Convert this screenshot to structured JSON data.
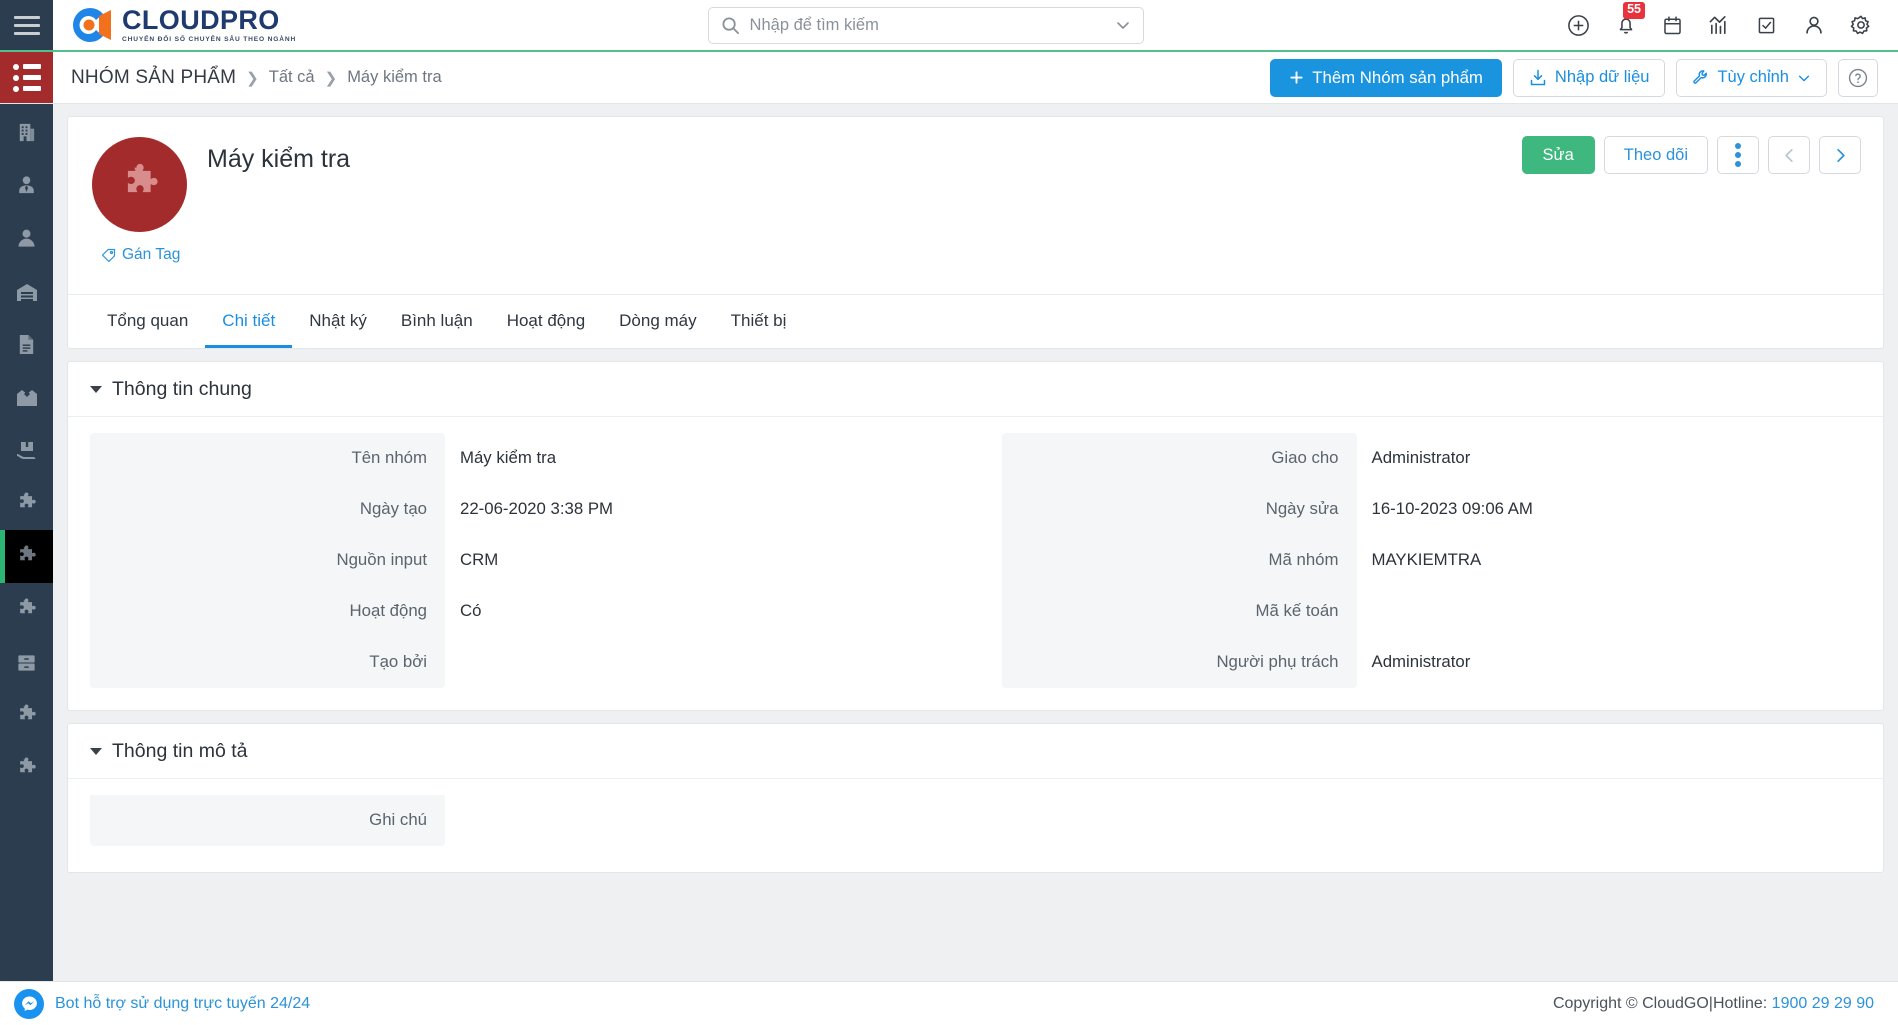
{
  "brand": {
    "name": "CLOUDPRO",
    "tagline": "CHUYỂN ĐỔI SỐ CHUYÊN SÂU THEO NGÀNH",
    "accent_blue": "#1a94de",
    "accent_green": "#52c08a",
    "sidebar_bg": "#2b3d4f",
    "red": "#a32b2b"
  },
  "topbar": {
    "menu_icon": "hamburger-icon",
    "search": {
      "placeholder": "Nhập để tìm kiếm",
      "value": "",
      "icon": "search-icon",
      "dropdown_icon": "chevron-down-icon"
    },
    "icons": [
      {
        "name": "add-circle-icon",
        "glyph": "plus"
      },
      {
        "name": "notifications-bell-icon",
        "glyph": "bell",
        "badge": "55"
      },
      {
        "name": "calendar-icon",
        "glyph": "calendar"
      },
      {
        "name": "reports-chart-icon",
        "glyph": "chart"
      },
      {
        "name": "tasks-checkbox-icon",
        "glyph": "check"
      },
      {
        "name": "user-account-icon",
        "glyph": "user"
      },
      {
        "name": "settings-gear-icon",
        "glyph": "gear"
      }
    ]
  },
  "actionbar": {
    "module_icon": "list-module-icon",
    "breadcrumb": {
      "module": "NHÓM SẢN PHẨM",
      "items": [
        "Tất cả",
        "Máy kiểm tra"
      ],
      "separator": "❯"
    },
    "buttons": {
      "add": "Thêm Nhóm sản phẩm",
      "import": "Nhập dữ liệu",
      "customize": "Tùy chỉnh",
      "help_icon": "help-circle-icon"
    }
  },
  "sidebar": {
    "items": [
      {
        "name": "sidebar-item-organizations",
        "icon": "building-icon",
        "active": false
      },
      {
        "name": "sidebar-item-contacts",
        "icon": "user-tie-icon",
        "active": false
      },
      {
        "name": "sidebar-item-persons",
        "icon": "person-icon",
        "active": false
      },
      {
        "name": "sidebar-item-warehouse",
        "icon": "warehouse-icon",
        "active": false
      },
      {
        "name": "sidebar-item-documents",
        "icon": "document-icon",
        "active": false
      },
      {
        "name": "sidebar-item-open-box",
        "icon": "open-box-icon",
        "active": false
      },
      {
        "name": "sidebar-item-delivery",
        "icon": "box-hand-icon",
        "active": false
      },
      {
        "name": "sidebar-item-products",
        "icon": "puzzle-icon",
        "active": false
      },
      {
        "name": "sidebar-item-product-group",
        "icon": "puzzle-icon",
        "active": true
      },
      {
        "name": "sidebar-item-modules",
        "icon": "puzzle-icon",
        "active": false
      },
      {
        "name": "sidebar-item-archive",
        "icon": "archive-drawer-icon",
        "active": false
      },
      {
        "name": "sidebar-item-extensions",
        "icon": "puzzle-icon",
        "active": false
      },
      {
        "name": "sidebar-item-addons",
        "icon": "puzzle-icon",
        "active": false
      }
    ]
  },
  "record": {
    "avatar_icon": "puzzle-icon",
    "title": "Máy kiểm tra",
    "tag_label": "Gán Tag",
    "tag_icon": "tag-icon",
    "actions": {
      "edit": "Sửa",
      "follow": "Theo dõi",
      "more_icon": "vertical-dots-icon",
      "prev_icon": "chevron-left-icon",
      "next_icon": "chevron-right-icon"
    }
  },
  "tabs": [
    {
      "label": "Tổng quan",
      "active": false
    },
    {
      "label": "Chi tiết",
      "active": true
    },
    {
      "label": "Nhật ký",
      "active": false
    },
    {
      "label": "Bình luận",
      "active": false
    },
    {
      "label": "Hoạt động",
      "active": false
    },
    {
      "label": "Dòng máy",
      "active": false
    },
    {
      "label": "Thiết bị",
      "active": false
    }
  ],
  "sections": [
    {
      "title": "Thông tin chung",
      "left_fields": [
        {
          "label": "Tên nhóm",
          "value": "Máy kiểm tra"
        },
        {
          "label": "Ngày tạo",
          "value": "22-06-2020 3:38 PM"
        },
        {
          "label": "Nguồn input",
          "value": "CRM"
        },
        {
          "label": "Hoạt động",
          "value": "Có"
        },
        {
          "label": "Tạo bởi",
          "value": ""
        }
      ],
      "right_fields": [
        {
          "label": "Giao cho",
          "value": "Administrator"
        },
        {
          "label": "Ngày sửa",
          "value": "16-10-2023 09:06 AM"
        },
        {
          "label": "Mã nhóm",
          "value": "MAYKIEMTRA"
        },
        {
          "label": "Mã kế toán",
          "value": ""
        },
        {
          "label": "Người phụ trách",
          "value": "Administrator"
        }
      ]
    },
    {
      "title": "Thông tin mô tả",
      "left_fields": [
        {
          "label": "Ghi chú",
          "value": ""
        }
      ],
      "right_fields": []
    }
  ],
  "footer": {
    "bot_label": "Bot hỗ trợ sử dụng trực tuyến 24/24",
    "bot_icon": "messenger-icon",
    "copyright": "Copyright © CloudGO|Hotline:",
    "hotline": "1900 29 29 90"
  }
}
